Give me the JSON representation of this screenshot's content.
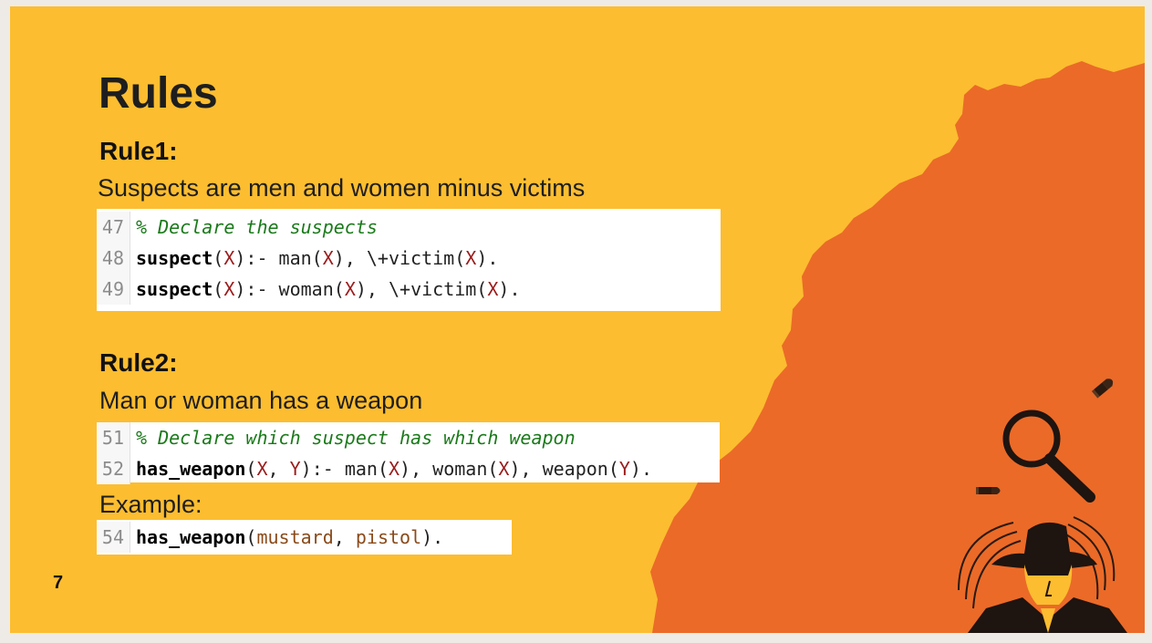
{
  "slide": {
    "title": "Rules",
    "page_number": "7",
    "colors": {
      "background": "#fcbd30",
      "accent": "#eb6a28"
    }
  },
  "rule1": {
    "heading": "Rule1:",
    "description": "Suspects are men and women minus victims",
    "code": [
      {
        "line_no": "47",
        "comment": "% Declare the suspects"
      },
      {
        "line_no": "48",
        "pred": "suspect",
        "t1": "(",
        "v1": "X",
        "t2": "):- man(",
        "v2": "X",
        "t3": "), \\+victim(",
        "v3": "X",
        "t4": ")."
      },
      {
        "line_no": "49",
        "pred": "suspect",
        "t1": "(",
        "v1": "X",
        "t2": "):- woman(",
        "v2": "X",
        "t3": "), \\+victim(",
        "v3": "X",
        "t4": ")."
      }
    ]
  },
  "rule2": {
    "heading": "Rule2:",
    "description": "Man or  woman has a weapon",
    "code": [
      {
        "line_no": "51",
        "comment": "% Declare which suspect has which weapon"
      },
      {
        "line_no": "52",
        "pred": "has_weapon",
        "t1": "(",
        "v1": "X",
        "t2": ", ",
        "v2": "Y",
        "t3": "):- man(",
        "v3": "X",
        "t4": "), woman(",
        "v4": "X",
        "t5": "), weapon(",
        "v5": "Y",
        "t6": ")."
      }
    ]
  },
  "example": {
    "label": "Example:",
    "code": {
      "line_no": "54",
      "pred": "has_weapon",
      "t1": "(",
      "a1": "mustard",
      "t2": ", ",
      "a2": "pistol",
      "t3": ")."
    }
  },
  "illustrations": [
    "bullet-icon",
    "magnifying-glass-icon",
    "bullet-icon",
    "detective-illustration"
  ]
}
